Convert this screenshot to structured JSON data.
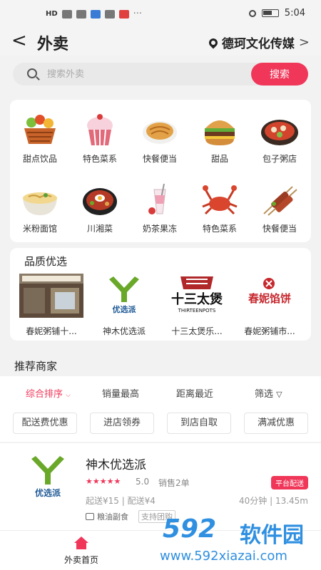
{
  "status_bar": {
    "time": "5:04",
    "network": "HD"
  },
  "header": {
    "back_icon": "chevron-left-icon",
    "title": "外卖",
    "location": "德珂文化传媒"
  },
  "search": {
    "placeholder": "搜索外卖",
    "button_label": "搜索"
  },
  "categories": [
    {
      "label": "甜点饮品",
      "icon": "fruit-basket-icon"
    },
    {
      "label": "特色菜系",
      "icon": "cupcake-icon"
    },
    {
      "label": "快餐便当",
      "icon": "pancake-icon"
    },
    {
      "label": "甜品",
      "icon": "burger-icon"
    },
    {
      "label": "包子粥店",
      "icon": "hotpot-icon"
    },
    {
      "label": "米粉面馆",
      "icon": "noodle-bowl-icon"
    },
    {
      "label": "川湘菜",
      "icon": "bibimbap-icon"
    },
    {
      "label": "奶茶果冻",
      "icon": "milkshake-icon"
    },
    {
      "label": "特色菜系",
      "icon": "crab-icon"
    },
    {
      "label": "快餐便当",
      "icon": "skewers-icon"
    }
  ],
  "quality": {
    "title": "品质优选",
    "items": [
      {
        "label": "春妮粥铺十...",
        "image": "storefront-photo"
      },
      {
        "label": "神木优选派",
        "image": "youxuanpai-logo",
        "logo_text": "优选派"
      },
      {
        "label": "十三太煲乐...",
        "image": "shisantaibao-logo",
        "logo_text": "十三太煲",
        "logo_sub": "THIRTEENPOTS"
      },
      {
        "label": "春妮粥铺市...",
        "image": "chunni-logo",
        "logo_text": "春妮馅饼"
      }
    ]
  },
  "recommend": {
    "title": "推荐商家",
    "sort_tabs": [
      "综合排序",
      "销量最高",
      "距离最近",
      "筛选"
    ],
    "filters": [
      "配送费优惠",
      "进店领券",
      "到店自取",
      "满减优惠"
    ]
  },
  "shop": {
    "name": "神木优选派",
    "logo_text": "优选派",
    "stars": "★★★★★",
    "rating": "5.0",
    "sales": "销售2单",
    "badge": "平台配送",
    "delivery": "起送¥15 | 配送¥4",
    "eta": "40分钟 | 13.45m",
    "category": "粮油副食",
    "tag": "支持团购"
  },
  "bottom_nav": {
    "home_label": "外卖首页"
  },
  "watermark": {
    "brand": "592",
    "brand_cn": "软件园",
    "url": "www.592xiazai.com"
  },
  "colors": {
    "accent": "#f0375a",
    "watermark": "#2f8fe0",
    "logo_green": "#6aa82a"
  }
}
